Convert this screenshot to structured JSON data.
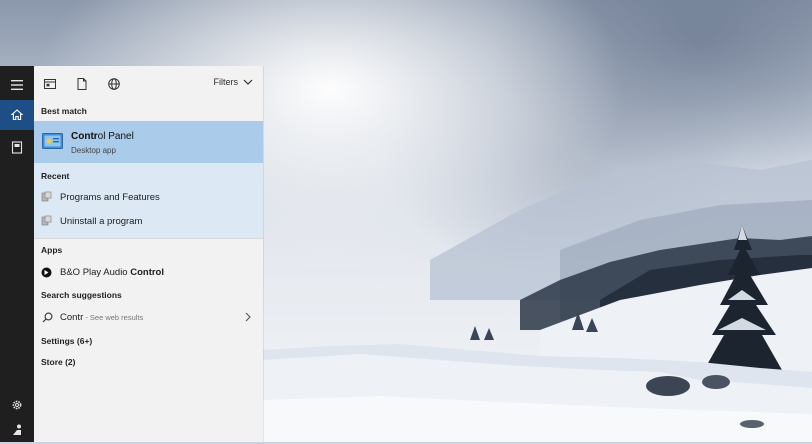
{
  "toolbar": {
    "filters_label": "Filters"
  },
  "best_match": {
    "heading": "Best match",
    "title_match": "Contr",
    "title_rest": "ol Panel",
    "subtitle": "Desktop app"
  },
  "recent": {
    "heading": "Recent",
    "items": [
      {
        "label": "Programs and Features"
      },
      {
        "label": "Uninstall a program"
      }
    ]
  },
  "apps": {
    "heading": "Apps",
    "item_prefix": "B&O Play Audio ",
    "item_match": "Control"
  },
  "search_suggestions": {
    "heading": "Search suggestions",
    "query": "Contr",
    "hint": " - See web results"
  },
  "settings_heading": "Settings (6+)",
  "store_heading": "Store (2)",
  "icons": {
    "menu": "hamburger-icon",
    "home": "home-icon",
    "notebook": "notebook-icon",
    "settings": "gear-icon",
    "user": "person-icon",
    "apps_tab": "apps-tab-icon",
    "documents_tab": "document-icon",
    "web_tab": "globe-icon"
  },
  "colors": {
    "accent": "#1d4f86",
    "best_match_bg": "#aacbea",
    "recent_bg": "#dce8f4",
    "panel_bg": "#f2f2f2",
    "rail_bg": "#1f1f1f"
  }
}
